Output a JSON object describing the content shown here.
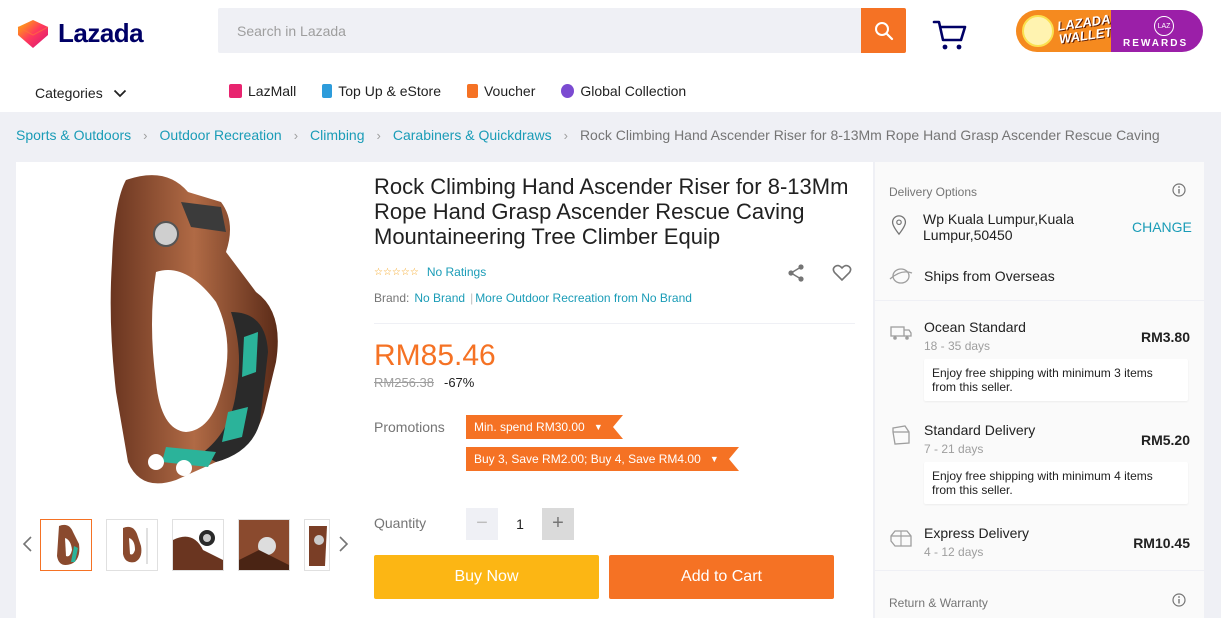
{
  "header": {
    "logo_text": "Lazada",
    "search_placeholder": "Search in Lazada",
    "wallet": {
      "title_line1": "LAZADA",
      "title_line2": "WALLET",
      "badge": "LAZ",
      "rewards": "REWARDS"
    }
  },
  "nav": {
    "categories_label": "Categories",
    "links": [
      {
        "label": "LazMall",
        "icon": "lazmall-icon",
        "color": "#e8246f"
      },
      {
        "label": "Top Up & eStore",
        "icon": "topup-icon",
        "color": "#2d9cdb"
      },
      {
        "label": "Voucher",
        "icon": "voucher-icon",
        "color": "#f57224"
      },
      {
        "label": "Global Collection",
        "icon": "global-collection-icon",
        "color": "#7b4bd1"
      }
    ]
  },
  "breadcrumb": {
    "items": [
      "Sports & Outdoors",
      "Outdoor Recreation",
      "Climbing",
      "Carabiners & Quickdraws"
    ],
    "current": "Rock Climbing Hand Ascender Riser for 8-13Mm Rope Hand Grasp Ascender Rescue Caving"
  },
  "product": {
    "title": "Rock Climbing Hand Ascender Riser for 8-13Mm Rope Hand Grasp Ascender Rescue Caving Mountaineering Tree Climber Equip",
    "ratings_text": "No Ratings",
    "brand_label": "Brand:",
    "brand_value": "No Brand",
    "brand_more": "More Outdoor Recreation from No Brand",
    "price": "RM85.46",
    "original_price": "RM256.38",
    "discount": "-67%",
    "promotions_label": "Promotions",
    "promotions": [
      "Min. spend RM30.00",
      "Buy 3, Save RM2.00; Buy 4, Save RM4.00"
    ],
    "quantity_label": "Quantity",
    "quantity": "1",
    "buy_now": "Buy Now",
    "add_to_cart": "Add to Cart"
  },
  "delivery": {
    "header": "Delivery Options",
    "location": "Wp Kuala Lumpur,Kuala Lumpur,50450",
    "change": "CHANGE",
    "ships_from": "Ships from Overseas",
    "options": [
      {
        "name": "Ocean Standard",
        "days": "18 - 35 days",
        "price": "RM3.80",
        "note": "Enjoy free shipping with minimum 3 items from this seller."
      },
      {
        "name": "Standard Delivery",
        "days": "7 - 21 days",
        "price": "RM5.20",
        "note": "Enjoy free shipping with minimum 4 items from this seller."
      },
      {
        "name": "Express Delivery",
        "days": "4 - 12 days",
        "price": "RM10.45",
        "note": ""
      }
    ],
    "return_header": "Return & Warranty"
  },
  "colors": {
    "accent": "#f57224",
    "link": "#1a9cb7",
    "buy_now": "#fcb614",
    "brand_navy": "#000066"
  }
}
